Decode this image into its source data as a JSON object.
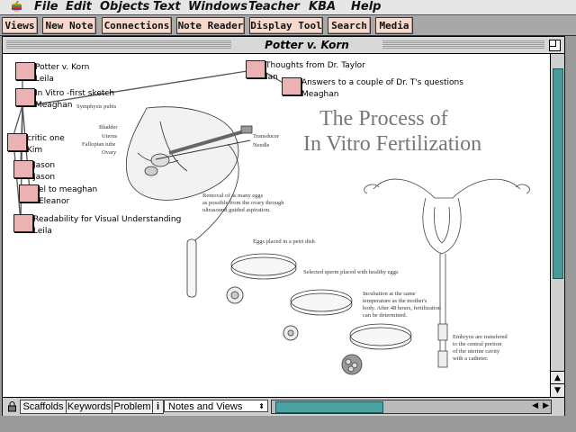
{
  "menu": {
    "items": [
      "File",
      "Edit",
      "Objects",
      "Text",
      "Windows",
      "Teacher",
      "KBA",
      "Help"
    ]
  },
  "toolbar": {
    "buttons": [
      "Views",
      "New Note",
      "Connections",
      "Note Reader",
      "Display Tool",
      "Search",
      "Media"
    ]
  },
  "window": {
    "title": "Potter v. Korn"
  },
  "notes": [
    {
      "title": "Potter v. Korn",
      "author": "Leila"
    },
    {
      "title": "In Vitro -first sketch",
      "author": "Meaghan"
    },
    {
      "title": "critic one",
      "author": "Kim"
    },
    {
      "title": "Jason",
      "author": "Jason"
    },
    {
      "title": "el to meaghan",
      "author": "Eleanor"
    },
    {
      "title": "Readability for Visual Understanding",
      "author": "Leila"
    },
    {
      "title": "Thoughts from Dr. Taylor",
      "author": "Ian"
    },
    {
      "title": "Answers to a couple of Dr. T's questions",
      "author": "Meaghan"
    }
  ],
  "illustration": {
    "title_line1": "The Process of",
    "title_line2": "In Vitro Fertilization",
    "labels": {
      "symphysis": "Symphysis pubis",
      "bladder": "Bladder",
      "uterus": "Uterus",
      "fallopian": "Fallopian tube",
      "ovary": "Ovary",
      "transducer": "Transducer",
      "needle": "Needle"
    },
    "captions": {
      "removal": [
        "Removal of as many eggs",
        "as possible from the ovary through",
        "ultrasound guided aspiration."
      ],
      "eggs": [
        "Eggs placed in a petri dish"
      ],
      "sperm": [
        "Selected sperm placed with healthy eggs"
      ],
      "incubation": [
        "Incubation at the same",
        "temperature as the mother's",
        "body. After 48 hours, fertilization",
        "can be determined."
      ],
      "embryos": [
        "Embryos are transfered",
        "to the central portion",
        "of the uterine cavity",
        "with a catheter."
      ]
    }
  },
  "bottombar": {
    "scaffolds": "Scaffolds",
    "keywords": "Keywords",
    "problem": "Problem",
    "info": "i",
    "view_select": "Notes and Views"
  },
  "colors": {
    "node_fill": "#eab2b2",
    "toolbar_button": "#f4d9cc",
    "scroll_thumb": "#4a9a9a"
  }
}
